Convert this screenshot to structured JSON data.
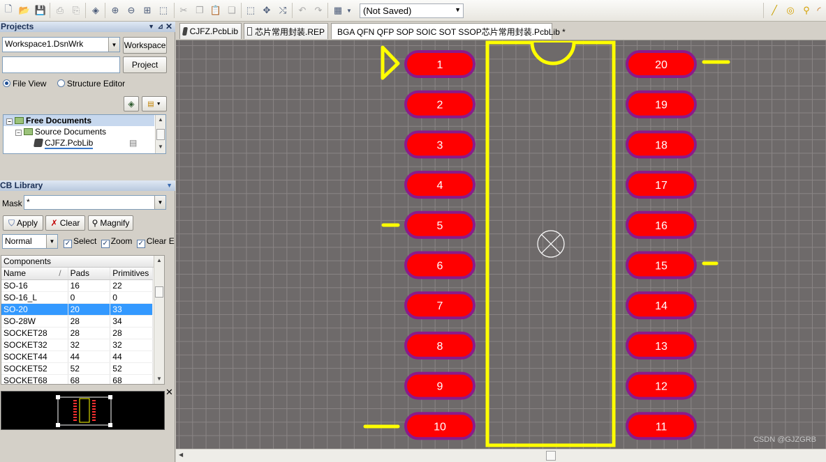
{
  "toolbar": {
    "status_value": "(Not Saved)"
  },
  "projects_panel": {
    "title": "Projects",
    "workspace_value": "Workspace1.DsnWrk",
    "workspace_button": "Workspace",
    "project_button": "Project",
    "view_options": [
      "File View",
      "Structure Editor"
    ],
    "tree": {
      "root": "Free Documents",
      "child": "Source Documents",
      "file": "CJFZ.PcbLib"
    }
  },
  "pcb_library": {
    "title": "PCB Library",
    "mask_label": "Mask",
    "mask_value": "*",
    "apply": "Apply",
    "clear": "Clear",
    "magnify": "Magnify",
    "mode_value": "Normal",
    "checks": [
      "Select",
      "Zoom",
      "Clear Exi"
    ],
    "components_header": "Components",
    "columns": [
      "Name",
      "Pads",
      "Primitives"
    ],
    "sort_indicator": "/",
    "rows": [
      [
        "SO-16",
        "16",
        "22"
      ],
      [
        "SO-16_L",
        "0",
        "0"
      ],
      [
        "SO-20",
        "20",
        "33"
      ],
      [
        "SO-28W",
        "28",
        "34"
      ],
      [
        "SOCKET28",
        "28",
        "28"
      ],
      [
        "SOCKET32",
        "32",
        "32"
      ],
      [
        "SOCKET44",
        "44",
        "44"
      ],
      [
        "SOCKET52",
        "52",
        "52"
      ],
      [
        "SOCKET68",
        "68",
        "68"
      ]
    ],
    "selected_row": 2
  },
  "tabs": [
    {
      "label": "CJFZ.PcbLib",
      "icon": "chip-icon"
    },
    {
      "label": "芯片常用封装.REP",
      "icon": "document-icon"
    },
    {
      "label": "BGA QFN QFP SOP SOIC SOT SSOP芯片常用封装.PcbLib *",
      "icon": "chip-icon"
    }
  ],
  "footprint": {
    "left_pads": [
      "1",
      "2",
      "3",
      "4",
      "5",
      "6",
      "7",
      "8",
      "9",
      "10"
    ],
    "right_pads": [
      "20",
      "19",
      "18",
      "17",
      "16",
      "15",
      "14",
      "13",
      "12",
      "11"
    ],
    "colors": {
      "pad_fill": "#ff0000",
      "pad_ring": "#8b1a8b",
      "silkscreen": "#ffff00",
      "background": "#6e6a6a",
      "grid": "#8a8585"
    }
  },
  "watermark": "CSDN @GJZGRB"
}
